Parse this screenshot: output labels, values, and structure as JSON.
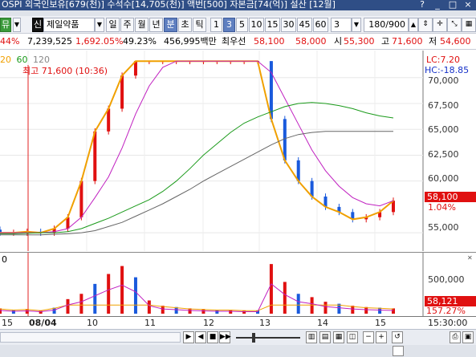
{
  "titlebar": {
    "text": "OSPI 외국인보유[679(천)] 수석수[14,705(천)] 액번[500] 자본금[74(억)] 설산 [12월]",
    "help": "?",
    "minimize": "_",
    "maximize": "□",
    "close": "×"
  },
  "toolbar": {
    "stock_button": "뮤",
    "credit_badge": "신",
    "stock_name": "제일약품",
    "period_buttons": [
      "일",
      "주",
      "월",
      "년",
      "분",
      "초",
      "틱"
    ],
    "minute_buttons": [
      "1",
      "3",
      "5",
      "10",
      "15",
      "30",
      "45",
      "60"
    ],
    "interval_value": "3",
    "count_value": "180/900",
    "active_period": "분",
    "active_minute": "3"
  },
  "infobar": {
    "change_pct": "44%",
    "volume": "7,239,525",
    "volume_change": "1,692.05%",
    "turnover": "49.23%",
    "amount": "456,995백만",
    "best_bid_label": "최우선",
    "best_bid": "58,100",
    "best_ask": "58,000",
    "open_label": "시",
    "open": "55,300",
    "high_label": "고",
    "high": "71,600",
    "low_label": "저",
    "low": "54,600"
  },
  "price_chart": {
    "ma_legend": [
      "20",
      "60",
      "120"
    ],
    "ma_colors": [
      "#f0a000",
      "#1a9a1a",
      "#888888"
    ],
    "high_annotation": "최고 71,600 (10:36)",
    "lc_label": "LC:7.20",
    "hc_label": "HC:-18.85",
    "y_ticks": [
      "70,000",
      "67,500",
      "65,000",
      "62,500",
      "60,000",
      "55,000"
    ],
    "current_price": "58,100",
    "current_pct": "1.04%",
    "up_color": "#e01010",
    "down_color": "#1a5adc"
  },
  "volume_chart": {
    "panel_label": "0",
    "y_tick": "500,000",
    "current_volume": "58,121",
    "current_pct": "157.27%"
  },
  "x_axis": {
    "labels": [
      "15",
      "08/04",
      "10",
      "11",
      "12",
      "13",
      "14",
      "15"
    ],
    "time_readout": "15:30:00"
  },
  "chart_data": {
    "type": "candlestick",
    "x_sessions": [
      "15",
      "08/04",
      "10",
      "11",
      "12",
      "13",
      "14",
      "15"
    ],
    "ylim": [
      54000,
      72000
    ],
    "y_ticks": [
      55000,
      60000,
      62500,
      65000,
      67500,
      70000
    ],
    "high": 71600,
    "low": 54600,
    "open": 55300,
    "last": 58100,
    "series": [
      {
        "values": [
          55000,
          55000,
          55100,
          55000,
          55400,
          56500,
          60000,
          64800,
          67000,
          70200,
          71600,
          71600,
          71600,
          71600,
          71600,
          71600,
          71600,
          71600,
          71600,
          71600,
          66000,
          62000,
          60000,
          58500,
          57500,
          57000,
          56300,
          56500,
          57000,
          58100
        ]
      },
      {
        "values": [
          55000,
          55000,
          55000,
          55000,
          55100,
          55400,
          56500,
          58400,
          60400,
          63200,
          66500,
          69200,
          71000,
          71600,
          71600,
          71600,
          71600,
          71600,
          71600,
          71600,
          70500,
          68000,
          65500,
          63000,
          61000,
          59500,
          58400,
          57800,
          57600,
          58100
        ]
      },
      {
        "values": [
          54900,
          54900,
          54950,
          55000,
          55000,
          55100,
          55400,
          55900,
          56400,
          57000,
          57600,
          58200,
          59000,
          60000,
          61200,
          62500,
          63600,
          64700,
          65600,
          66200,
          66700,
          67200,
          67500,
          67600,
          67500,
          67300,
          67000,
          66600,
          66300,
          66100
        ]
      },
      {
        "values": [
          54800,
          54800,
          54800,
          54800,
          54850,
          54900,
          55000,
          55200,
          55600,
          56000,
          56600,
          57200,
          57800,
          58500,
          59200,
          60000,
          60700,
          61400,
          62100,
          62800,
          63500,
          64100,
          64500,
          64700,
          64800,
          64800,
          64800,
          64800,
          64800,
          64800
        ]
      }
    ]
  }
}
